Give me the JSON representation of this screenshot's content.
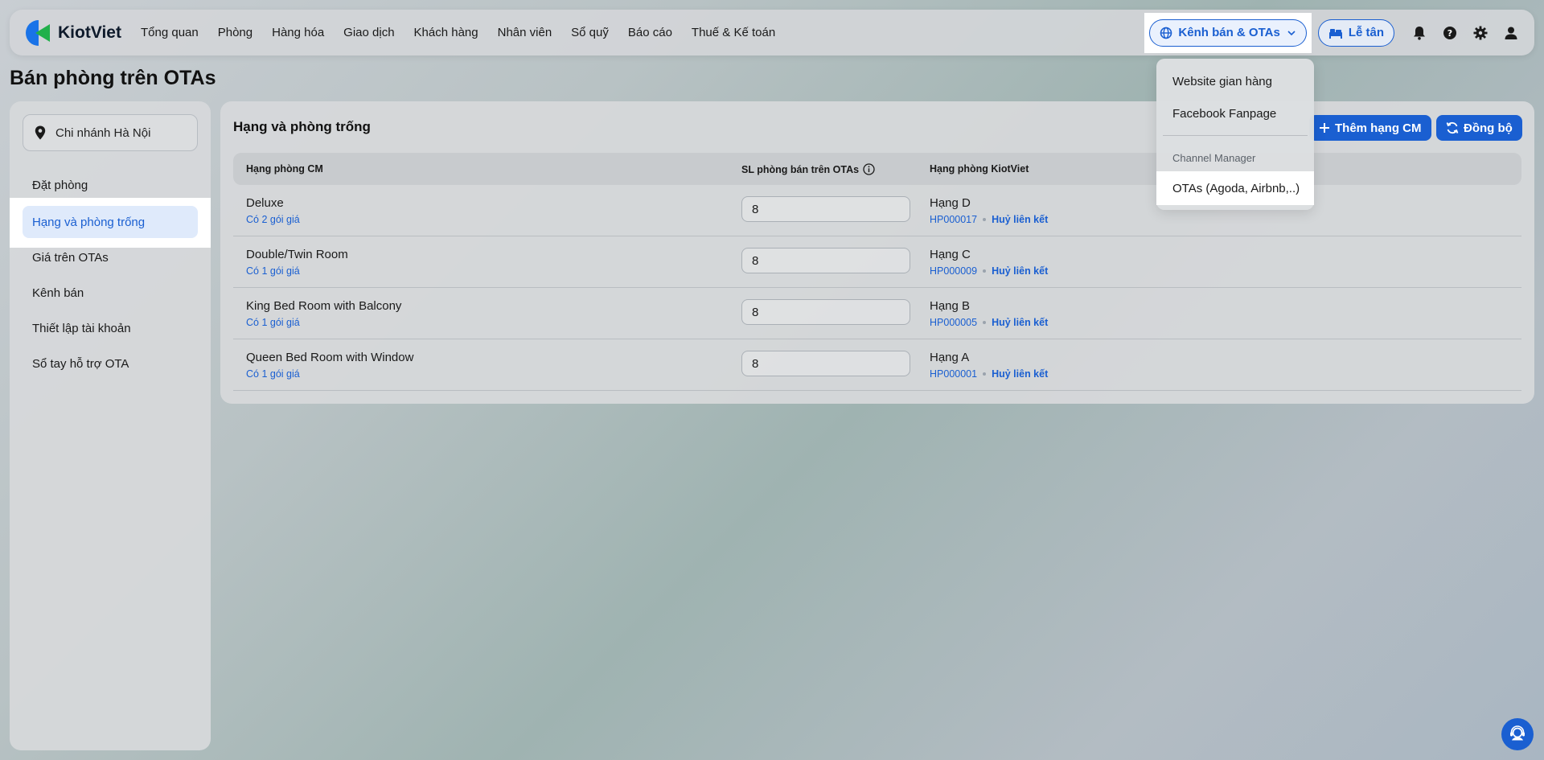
{
  "brand": {
    "name": "KiotViet"
  },
  "nav": {
    "items": [
      "Tổng quan",
      "Phòng",
      "Hàng hóa",
      "Giao dịch",
      "Khách hàng",
      "Nhân viên",
      "Sổ quỹ",
      "Báo cáo",
      "Thuế & Kế toán"
    ]
  },
  "header": {
    "channel_label": "Kênh bán & OTAs",
    "reception_label": "Lễ tân"
  },
  "page": {
    "title": "Bán phòng trên OTAs"
  },
  "sidebar": {
    "branch": "Chi nhánh Hà Nội",
    "items": [
      "Đặt phòng",
      "Hạng và phòng trống",
      "Giá trên OTAs",
      "Kênh bán",
      "Thiết lập tài khoản",
      "Sổ tay hỗ trợ OTA"
    ]
  },
  "main": {
    "title": "Hạng và phòng trống",
    "add_button": "Thêm hạng CM",
    "sync_button": "Đồng bộ",
    "columns": [
      "Hạng phòng CM",
      "SL phòng bán trên OTAs",
      "Hạng phòng KiotViet"
    ],
    "rows": [
      {
        "cm_name": "Deluxe",
        "cm_sub": "Có 2 gói giá",
        "qty": "8",
        "kv_name": "Hạng D",
        "kv_code": "HP000017",
        "unlink": "Huỷ liên kết"
      },
      {
        "cm_name": "Double/Twin Room",
        "cm_sub": "Có 1 gói giá",
        "qty": "8",
        "kv_name": "Hạng C",
        "kv_code": "HP000009",
        "unlink": "Huỷ liên kết"
      },
      {
        "cm_name": "King Bed Room with Balcony",
        "cm_sub": "Có 1 gói giá",
        "qty": "8",
        "kv_name": "Hạng B",
        "kv_code": "HP000005",
        "unlink": "Huỷ liên kết"
      },
      {
        "cm_name": "Queen Bed Room with Window",
        "cm_sub": "Có 1 gói giá",
        "qty": "8",
        "kv_name": "Hạng A",
        "kv_code": "HP000001",
        "unlink": "Huỷ liên kết"
      }
    ]
  },
  "dropdown": {
    "items": [
      "Website gian hàng",
      "Facebook Fanpage"
    ],
    "section": "Channel Manager",
    "active": "OTAs (Agoda, Airbnb,..)"
  },
  "colors": {
    "accent": "#1a5fd1",
    "brand_green": "#21b04b",
    "active_bg": "#dfeafb"
  },
  "icons": [
    "globe-icon",
    "chevron-down-icon",
    "bed-icon",
    "bell-icon",
    "help-icon",
    "gear-icon",
    "user-icon",
    "location-pin-icon",
    "plus-icon",
    "sync-icon",
    "info-icon",
    "support-chat-icon"
  ]
}
